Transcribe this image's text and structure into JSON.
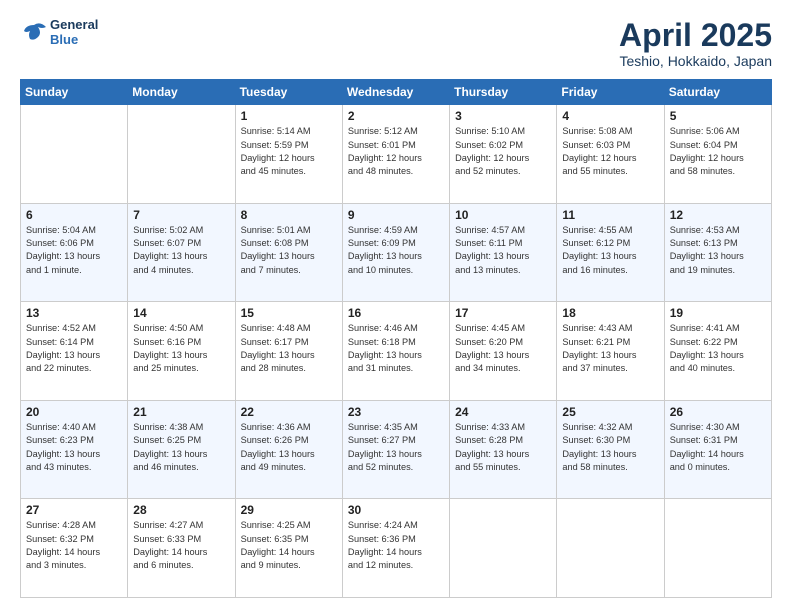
{
  "header": {
    "logo_line1": "General",
    "logo_line2": "Blue",
    "month": "April 2025",
    "location": "Teshio, Hokkaido, Japan"
  },
  "weekdays": [
    "Sunday",
    "Monday",
    "Tuesday",
    "Wednesday",
    "Thursday",
    "Friday",
    "Saturday"
  ],
  "weeks": [
    [
      {
        "day": "",
        "info": ""
      },
      {
        "day": "",
        "info": ""
      },
      {
        "day": "1",
        "info": "Sunrise: 5:14 AM\nSunset: 5:59 PM\nDaylight: 12 hours\nand 45 minutes."
      },
      {
        "day": "2",
        "info": "Sunrise: 5:12 AM\nSunset: 6:01 PM\nDaylight: 12 hours\nand 48 minutes."
      },
      {
        "day": "3",
        "info": "Sunrise: 5:10 AM\nSunset: 6:02 PM\nDaylight: 12 hours\nand 52 minutes."
      },
      {
        "day": "4",
        "info": "Sunrise: 5:08 AM\nSunset: 6:03 PM\nDaylight: 12 hours\nand 55 minutes."
      },
      {
        "day": "5",
        "info": "Sunrise: 5:06 AM\nSunset: 6:04 PM\nDaylight: 12 hours\nand 58 minutes."
      }
    ],
    [
      {
        "day": "6",
        "info": "Sunrise: 5:04 AM\nSunset: 6:06 PM\nDaylight: 13 hours\nand 1 minute."
      },
      {
        "day": "7",
        "info": "Sunrise: 5:02 AM\nSunset: 6:07 PM\nDaylight: 13 hours\nand 4 minutes."
      },
      {
        "day": "8",
        "info": "Sunrise: 5:01 AM\nSunset: 6:08 PM\nDaylight: 13 hours\nand 7 minutes."
      },
      {
        "day": "9",
        "info": "Sunrise: 4:59 AM\nSunset: 6:09 PM\nDaylight: 13 hours\nand 10 minutes."
      },
      {
        "day": "10",
        "info": "Sunrise: 4:57 AM\nSunset: 6:11 PM\nDaylight: 13 hours\nand 13 minutes."
      },
      {
        "day": "11",
        "info": "Sunrise: 4:55 AM\nSunset: 6:12 PM\nDaylight: 13 hours\nand 16 minutes."
      },
      {
        "day": "12",
        "info": "Sunrise: 4:53 AM\nSunset: 6:13 PM\nDaylight: 13 hours\nand 19 minutes."
      }
    ],
    [
      {
        "day": "13",
        "info": "Sunrise: 4:52 AM\nSunset: 6:14 PM\nDaylight: 13 hours\nand 22 minutes."
      },
      {
        "day": "14",
        "info": "Sunrise: 4:50 AM\nSunset: 6:16 PM\nDaylight: 13 hours\nand 25 minutes."
      },
      {
        "day": "15",
        "info": "Sunrise: 4:48 AM\nSunset: 6:17 PM\nDaylight: 13 hours\nand 28 minutes."
      },
      {
        "day": "16",
        "info": "Sunrise: 4:46 AM\nSunset: 6:18 PM\nDaylight: 13 hours\nand 31 minutes."
      },
      {
        "day": "17",
        "info": "Sunrise: 4:45 AM\nSunset: 6:20 PM\nDaylight: 13 hours\nand 34 minutes."
      },
      {
        "day": "18",
        "info": "Sunrise: 4:43 AM\nSunset: 6:21 PM\nDaylight: 13 hours\nand 37 minutes."
      },
      {
        "day": "19",
        "info": "Sunrise: 4:41 AM\nSunset: 6:22 PM\nDaylight: 13 hours\nand 40 minutes."
      }
    ],
    [
      {
        "day": "20",
        "info": "Sunrise: 4:40 AM\nSunset: 6:23 PM\nDaylight: 13 hours\nand 43 minutes."
      },
      {
        "day": "21",
        "info": "Sunrise: 4:38 AM\nSunset: 6:25 PM\nDaylight: 13 hours\nand 46 minutes."
      },
      {
        "day": "22",
        "info": "Sunrise: 4:36 AM\nSunset: 6:26 PM\nDaylight: 13 hours\nand 49 minutes."
      },
      {
        "day": "23",
        "info": "Sunrise: 4:35 AM\nSunset: 6:27 PM\nDaylight: 13 hours\nand 52 minutes."
      },
      {
        "day": "24",
        "info": "Sunrise: 4:33 AM\nSunset: 6:28 PM\nDaylight: 13 hours\nand 55 minutes."
      },
      {
        "day": "25",
        "info": "Sunrise: 4:32 AM\nSunset: 6:30 PM\nDaylight: 13 hours\nand 58 minutes."
      },
      {
        "day": "26",
        "info": "Sunrise: 4:30 AM\nSunset: 6:31 PM\nDaylight: 14 hours\nand 0 minutes."
      }
    ],
    [
      {
        "day": "27",
        "info": "Sunrise: 4:28 AM\nSunset: 6:32 PM\nDaylight: 14 hours\nand 3 minutes."
      },
      {
        "day": "28",
        "info": "Sunrise: 4:27 AM\nSunset: 6:33 PM\nDaylight: 14 hours\nand 6 minutes."
      },
      {
        "day": "29",
        "info": "Sunrise: 4:25 AM\nSunset: 6:35 PM\nDaylight: 14 hours\nand 9 minutes."
      },
      {
        "day": "30",
        "info": "Sunrise: 4:24 AM\nSunset: 6:36 PM\nDaylight: 14 hours\nand 12 minutes."
      },
      {
        "day": "",
        "info": ""
      },
      {
        "day": "",
        "info": ""
      },
      {
        "day": "",
        "info": ""
      }
    ]
  ]
}
